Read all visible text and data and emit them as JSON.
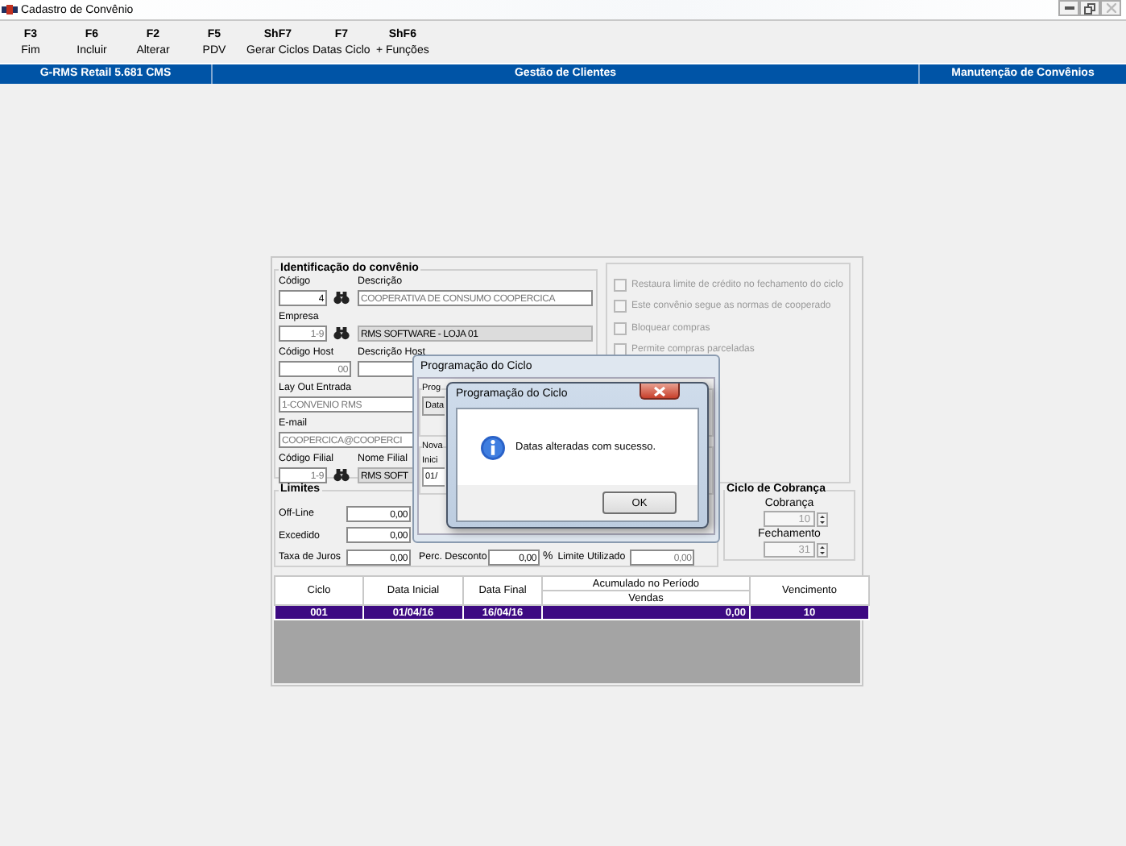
{
  "window": {
    "title": "Cadastro de Convênio"
  },
  "toolbar": [
    {
      "key": "F3",
      "label": "Fim"
    },
    {
      "key": "F6",
      "label": "Incluir"
    },
    {
      "key": "F2",
      "label": "Alterar"
    },
    {
      "key": "F5",
      "label": "PDV"
    },
    {
      "key": "ShF7",
      "label": "Gerar Ciclos"
    },
    {
      "key": "F7",
      "label": "Datas Ciclo"
    },
    {
      "key": "ShF6",
      "label": "+ Funções"
    }
  ],
  "header_bar": [
    "G-RMS Retail 5.681 CMS",
    "Gestão de Clientes",
    "Manutenção de Convênios"
  ],
  "identification": {
    "title": "Identificação do convênio",
    "codigo": {
      "label": "Código",
      "value": "4"
    },
    "descricao": {
      "label": "Descrição",
      "value": "COOPERATIVA DE CONSUMO COOPERCICA"
    },
    "empresa": {
      "label": "Empresa",
      "value": "1-9",
      "name": "RMS SOFTWARE - LOJA 01"
    },
    "codigo_host": {
      "label": "Código Host",
      "value": "00"
    },
    "descricao_host": {
      "label": "Descrição Host"
    },
    "layout_entrada": {
      "label": "Lay Out Entrada",
      "value": "1-CONVENIO RMS"
    },
    "email": {
      "label": "E-mail",
      "value": "COOPERCICA@COOPERCI"
    },
    "codigo_filial": {
      "label": "Código Filial",
      "value": "1-9"
    },
    "nome_filial": {
      "label": "Nome Filial",
      "value": "RMS SOFT"
    }
  },
  "options": [
    {
      "label": "Restaura limite de crédito no fechamento do ciclo",
      "checked": false,
      "disabled": true
    },
    {
      "label": "Este convênio segue as normas de cooperado",
      "checked": false,
      "disabled": true
    },
    {
      "label": "Bloquear compras",
      "checked": false,
      "disabled": true
    },
    {
      "label": "Permite compras parceladas",
      "checked": false,
      "disabled": true
    }
  ],
  "limits": {
    "title": "Limites",
    "fields": [
      {
        "label": "Off-Line",
        "value": "0,00"
      },
      {
        "label": "Excedido",
        "value": "0,00"
      },
      {
        "label": "Taxa de Juros",
        "value": "0,00"
      }
    ],
    "perc_desconto": {
      "label": "Perc. Desconto",
      "value": "0,00",
      "unit": "%"
    },
    "limite_utilizado": {
      "label": "Limite Utilizado",
      "value": "0,00"
    }
  },
  "billing_cycle": {
    "title": "Ciclo de Cobrança",
    "spinners": [
      {
        "label": "Cobrança",
        "value": "10"
      },
      {
        "label": "Fechamento",
        "value": "31"
      }
    ]
  },
  "table": {
    "columns": [
      "Ciclo",
      "Data Inicial",
      "Data Final",
      "Acumulado no Período",
      "Vencimento"
    ],
    "subcolumn": "Vendas",
    "rows": [
      {
        "cells": [
          "001",
          "01/04/16",
          "16/04/16",
          "0,00",
          "10"
        ],
        "selected": true
      }
    ]
  },
  "cycle_dialog": {
    "title": "Programação do Ciclo",
    "group_1": "Prog",
    "field_1": "Data",
    "group_2": "Nova",
    "label": "Inici",
    "field_2": "01/"
  },
  "message_box": {
    "title": "Programação do Ciclo",
    "message": "Datas alteradas com sucesso.",
    "button": "OK"
  }
}
